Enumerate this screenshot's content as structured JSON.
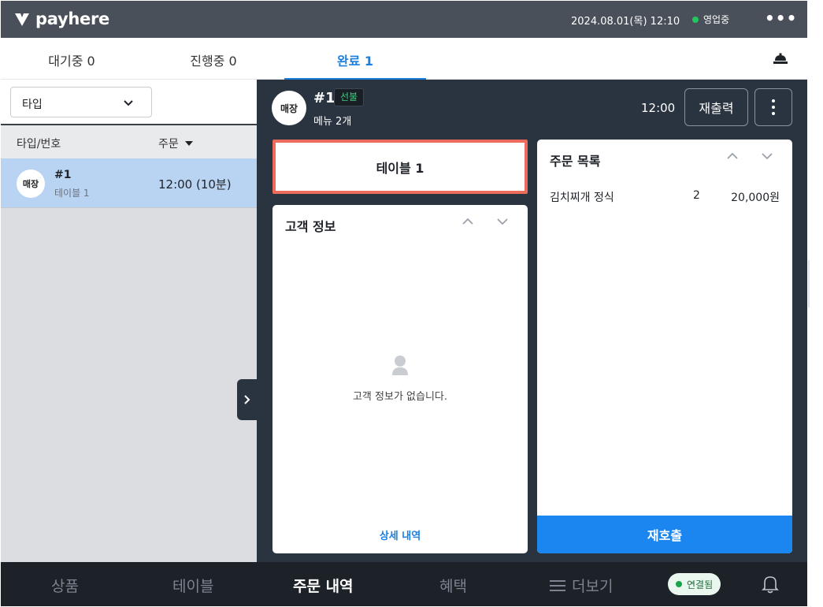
{
  "header": {
    "brand": "payhere",
    "datetime": "2024.08.01(목) 12:10",
    "status": "영업중",
    "status_color": "#22c55e",
    "more_icon": "more-horizontal-icon"
  },
  "tabs": [
    {
      "label": "대기중 0",
      "active": false
    },
    {
      "label": "진행중 0",
      "active": false
    },
    {
      "label": "완료 1",
      "active": true
    }
  ],
  "filter": {
    "selected": "타입"
  },
  "list": {
    "columns": {
      "type": "타입/번호",
      "order": "주문"
    },
    "rows": [
      {
        "avatar": "매장",
        "number": "#1",
        "table": "테이블 1",
        "time": "12:00 (10분)"
      }
    ]
  },
  "order": {
    "avatar": "매장",
    "number": "#1",
    "badge": "선불",
    "menu_count": "메뉴 2개",
    "time": "12:00",
    "reprint": "재출력",
    "table_label": "테이블 1"
  },
  "customer": {
    "title": "고객 정보",
    "empty": "고객 정보가 없습니다.",
    "detail": "상세 내역"
  },
  "order_list": {
    "title": "주문 목록",
    "items": [
      {
        "name": "김치찌개 정식",
        "qty": "2",
        "price": "20,000원"
      }
    ],
    "recall": "재호출"
  },
  "bottom_nav": {
    "items": [
      "상품",
      "테이블",
      "주문 내역",
      "혜택",
      "더보기"
    ],
    "active": "주문 내역",
    "connection": "연결됨"
  },
  "colors": {
    "accent": "#1b7fe0",
    "highlight_border": "#ec6b5a",
    "dark_panel": "#2a3441",
    "selected_row": "#b9d3f2"
  }
}
